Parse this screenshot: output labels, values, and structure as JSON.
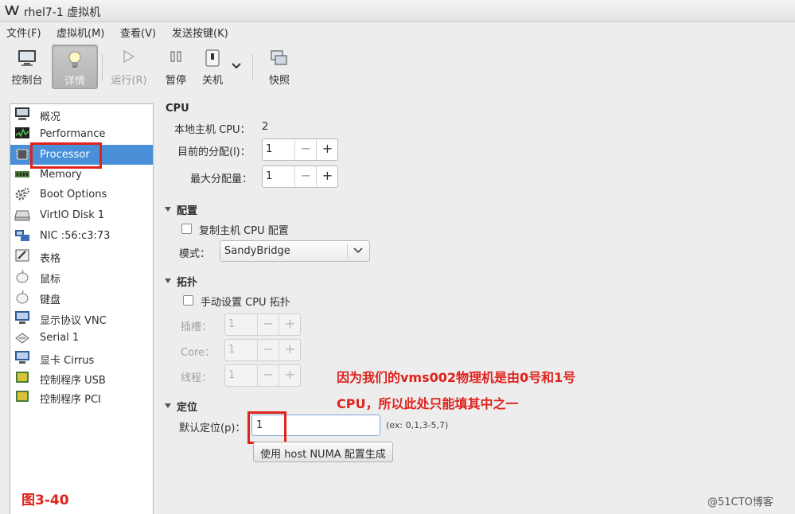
{
  "window": {
    "title": "rhel7-1 虚拟机"
  },
  "menu": [
    "文件(F)",
    "虚拟机(M)",
    "查看(V)",
    "发送按键(K)"
  ],
  "toolbar": {
    "console": "控制台",
    "details": "详情",
    "run": "运行(R)",
    "pause": "暂停",
    "shutdown": "关机",
    "snapshot": "快照"
  },
  "sidebar": [
    {
      "label": "概况",
      "icon": "monitor-icon"
    },
    {
      "label": "Performance",
      "icon": "performance-graph-icon"
    },
    {
      "label": "Processor",
      "icon": "cpu-chip-icon"
    },
    {
      "label": "Memory",
      "icon": "memory-icon"
    },
    {
      "label": "Boot Options",
      "icon": "gear-icon"
    },
    {
      "label": "VirtIO Disk 1",
      "icon": "disk-icon"
    },
    {
      "label": "NIC :56:c3:73",
      "icon": "network-icon"
    },
    {
      "label": "表格",
      "icon": "tablet-icon"
    },
    {
      "label": "鼠标",
      "icon": "mouse-icon"
    },
    {
      "label": "键盘",
      "icon": "keyboard-icon"
    },
    {
      "label": "显示协议 VNC",
      "icon": "display-icon"
    },
    {
      "label": "Serial 1",
      "icon": "serial-icon"
    },
    {
      "label": "显卡 Cirrus",
      "icon": "video-card-icon"
    },
    {
      "label": "控制程序 USB",
      "icon": "controller-icon"
    },
    {
      "label": "控制程序 PCI",
      "icon": "controller-icon"
    }
  ],
  "sidebar_selected": "Processor",
  "cpu": {
    "section_title": "CPU",
    "host_cpu_label": "本地主机 CPU：",
    "host_cpu_value": "2",
    "current_alloc_label": "目前的分配(l)：",
    "current_alloc_value": "1",
    "max_alloc_label": "最大分配量：",
    "max_alloc_value": "1"
  },
  "config": {
    "section_title": "配置",
    "copy_host_label": "复制主机 CPU 配置",
    "model_label": "模式：",
    "model_value": "SandyBridge"
  },
  "topology": {
    "section_title": "拓扑",
    "manual_label": "手动设置 CPU 拓扑",
    "sockets_label": "插槽：",
    "sockets_value": "1",
    "cores_label": "Core：",
    "cores_value": "1",
    "threads_label": "线程：",
    "threads_value": "1"
  },
  "pinning": {
    "section_title": "定位",
    "default_label": "默认定位(p)：",
    "default_value": "1",
    "hint": "(ex: 0,1,3-5,7)",
    "numa_button": "使用 host NUMA 配置生成"
  },
  "annotation": {
    "line1": "因为我们的vms002物理机是由0号和1号",
    "line2": "CPU，所以此处只能填其中之一",
    "figure": "图3-40",
    "watermark": "@51CTO博客"
  },
  "colors": {
    "selection": "#4a90d9",
    "annotation_red": "#e0211c"
  }
}
